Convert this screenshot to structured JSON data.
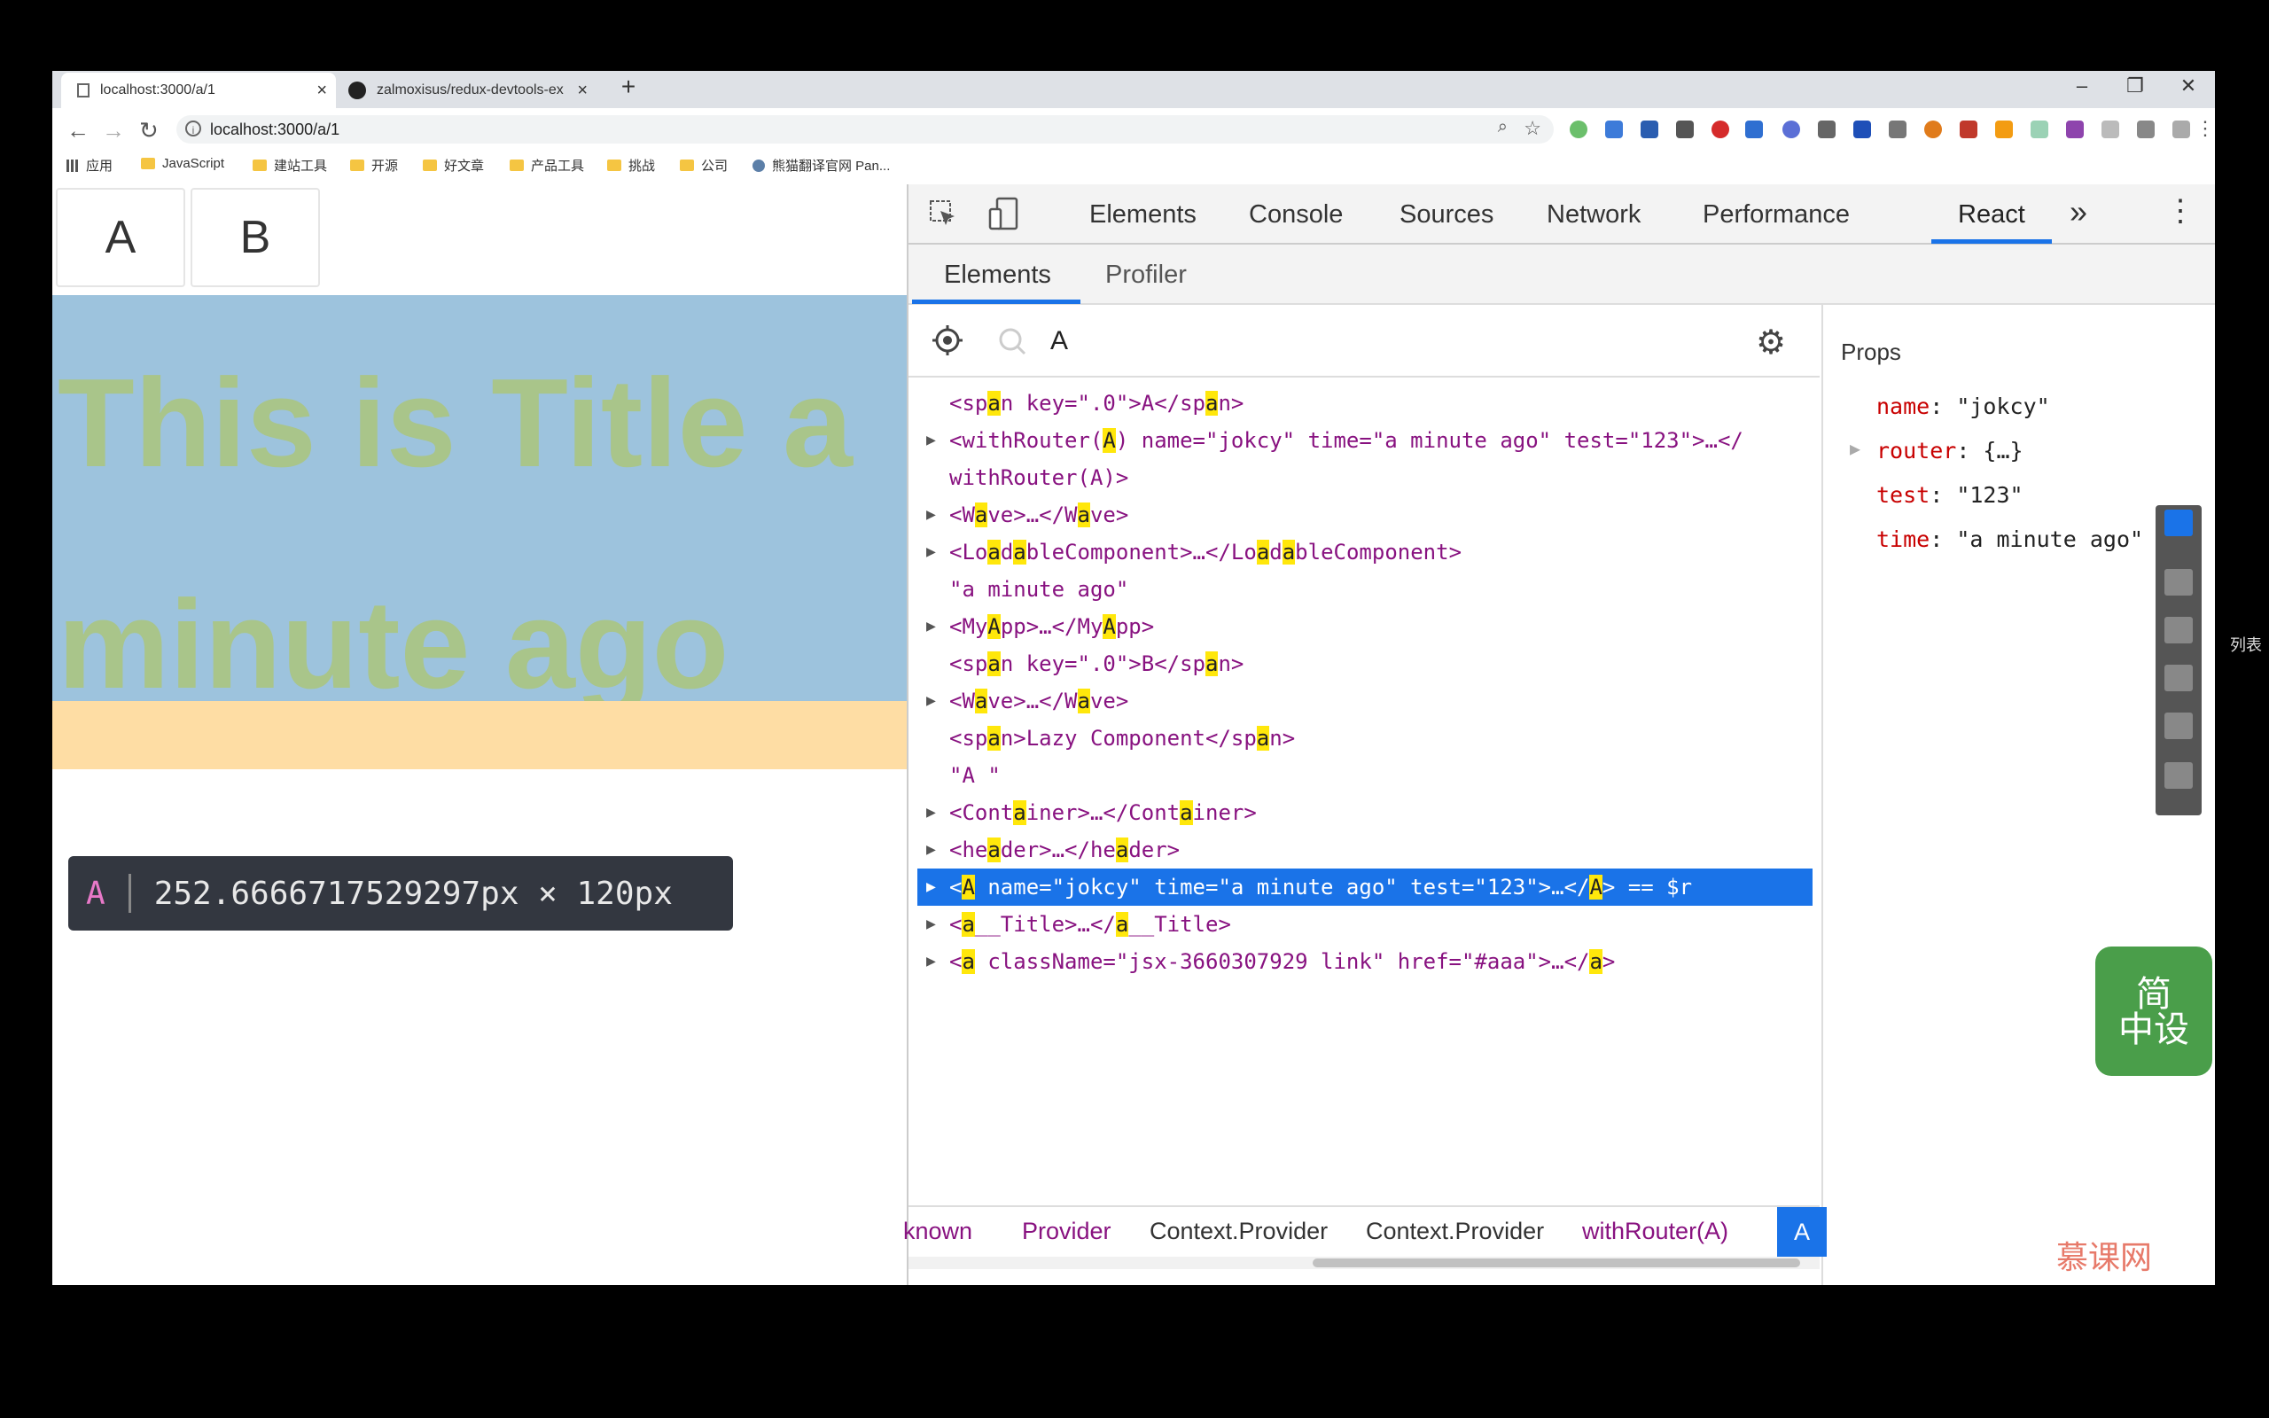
{
  "browser": {
    "tabs": [
      {
        "title": "localhost:3000/a/1",
        "close": "×"
      },
      {
        "title": "zalmoxisus/redux-devtools-ex",
        "close": "×"
      }
    ],
    "new_tab": "+",
    "window_buttons": {
      "minimize": "–",
      "restore": "❐",
      "close": "✕"
    },
    "nav": {
      "back": "←",
      "forward": "→",
      "reload": "↻"
    },
    "url": "localhost:3000/a/1",
    "bookmarks": [
      {
        "label": "应用",
        "icon": "apps-grid-icon"
      },
      {
        "label": "JavaScript",
        "icon": "folder-icon"
      },
      {
        "label": "建站工具",
        "icon": "folder-icon"
      },
      {
        "label": "开源",
        "icon": "folder-icon"
      },
      {
        "label": "好文章",
        "icon": "folder-icon"
      },
      {
        "label": "产品工具",
        "icon": "folder-icon"
      },
      {
        "label": "挑战",
        "icon": "folder-icon"
      },
      {
        "label": "公司",
        "icon": "folder-icon"
      },
      {
        "label": "熊猫翻译官网 Pan...",
        "icon": "panda-icon"
      }
    ]
  },
  "page": {
    "tab_a": "A",
    "tab_b": "B",
    "title_text": "This is Title a minute ago",
    "tooltip": {
      "name": "A",
      "dimensions": "252.6666717529297px × 120px"
    },
    "colors": {
      "title_bg": "#9dc3dd",
      "title_fg": "#a9c58a",
      "orange": "#fedda4"
    }
  },
  "devtools": {
    "tabs": [
      "Elements",
      "Console",
      "Sources",
      "Network",
      "Performance",
      "React"
    ],
    "active_tab": "React",
    "more": "»",
    "close": "✕",
    "subtabs": [
      "Elements",
      "Profiler"
    ],
    "search_value": "A",
    "tree": [
      {
        "arrow": "",
        "text": "<span key=\".0\">A</span>"
      },
      {
        "arrow": "▶",
        "text": "<withRouter(A) name=\"jokcy\" time=\"a minute ago\" test=\"123\">…</"
      },
      {
        "arrow": "",
        "text": "withRouter(A)>"
      },
      {
        "arrow": "▶",
        "text": "<Wave>…</Wave>"
      },
      {
        "arrow": "▶",
        "text": "<LoadableComponent>…</LoadableComponent>"
      },
      {
        "arrow": "",
        "text": "\"a minute ago\""
      },
      {
        "arrow": "▶",
        "text": "<MyApp>…</MyApp>"
      },
      {
        "arrow": "",
        "text": "<span key=\".0\">B</span>"
      },
      {
        "arrow": "▶",
        "text": "<Wave>…</Wave>"
      },
      {
        "arrow": "",
        "text": "<span>Lazy Component</span>"
      },
      {
        "arrow": "",
        "text": "\"A \""
      },
      {
        "arrow": "▶",
        "text": "<Container>…</Container>"
      },
      {
        "arrow": "▶",
        "text": "<header>…</header>"
      },
      {
        "arrow": "▶",
        "text": "<A name=\"jokcy\" time=\"a minute ago\" test=\"123\">…</A> == $r"
      },
      {
        "arrow": "▶",
        "text": "<a__Title>…</a__Title>"
      },
      {
        "arrow": "▶",
        "text": "<a className=\"jsx-3660307929 link\" href=\"#aaa\">…</a>"
      }
    ],
    "selected_row": 13,
    "props_title": "Props",
    "props": [
      {
        "key": "name",
        "value": "\"jokcy\"",
        "expandable": false
      },
      {
        "key": "router",
        "value": "{…}",
        "expandable": true
      },
      {
        "key": "test",
        "value": "\"123\"",
        "expandable": false
      },
      {
        "key": "time",
        "value": "\"a minute ago\"",
        "expandable": false
      }
    ],
    "breadcrumbs": [
      "known",
      "Provider",
      "Context.Provider",
      "Context.Provider",
      "withRouter(A)",
      "A"
    ]
  },
  "overlay": {
    "brand_label": "简\n中设",
    "watermark": "慕课网",
    "side_label": "列表"
  }
}
